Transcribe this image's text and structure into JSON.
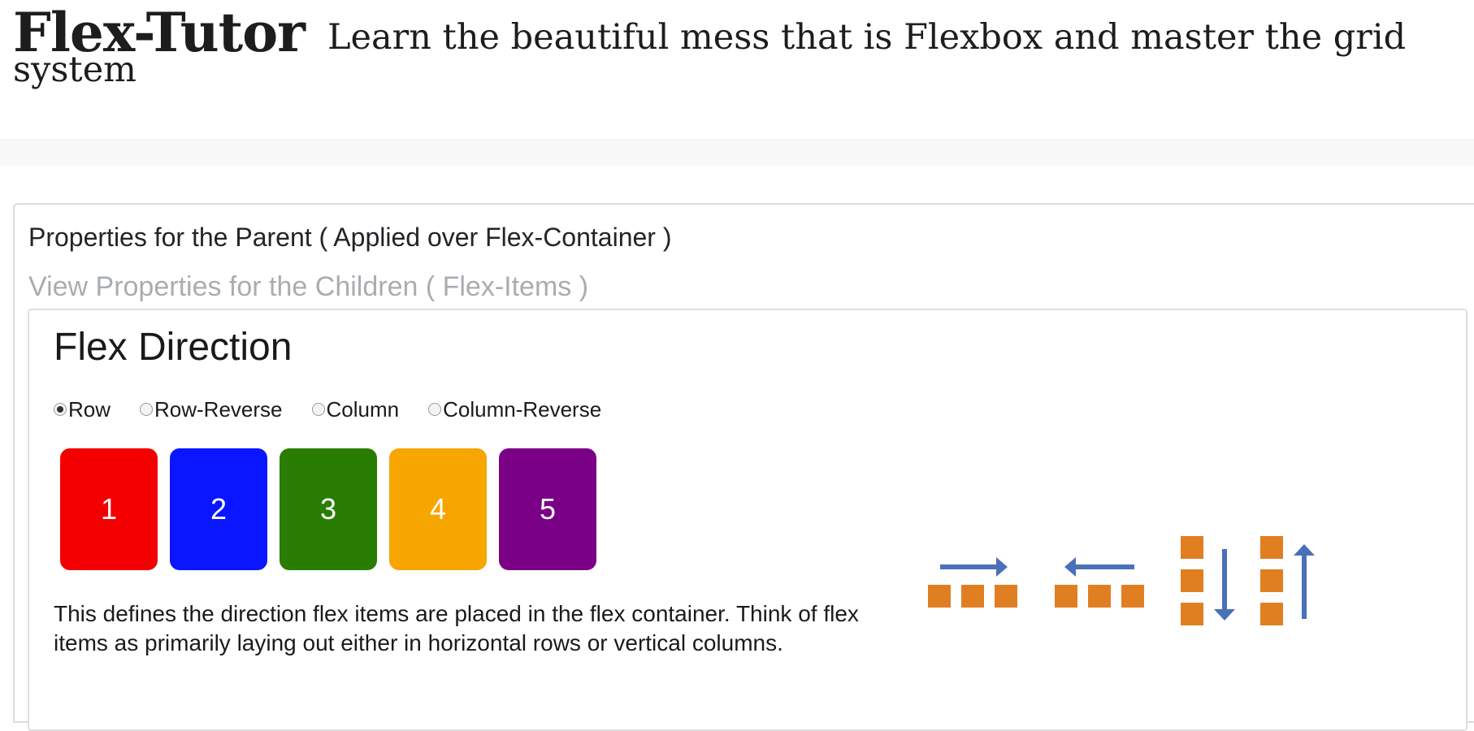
{
  "header": {
    "brand": "Flex-Tutor",
    "tagline_line1": "Learn the beautiful mess that is Flexbox and master the grid",
    "tagline_line2": "system"
  },
  "tabs": {
    "parent_label": "Properties for the Parent ( Applied over Flex-Container )",
    "children_label": "View Properties for the Children ( Flex-Items )"
  },
  "section": {
    "title": "Flex Direction",
    "radio_options": [
      {
        "label": "Row",
        "checked": true
      },
      {
        "label": "Row-Reverse",
        "checked": false
      },
      {
        "label": "Column",
        "checked": false
      },
      {
        "label": "Column-Reverse",
        "checked": false
      }
    ],
    "selected": "Row",
    "items": [
      {
        "label": "1",
        "color": "#f40000"
      },
      {
        "label": "2",
        "color": "#0a16ff"
      },
      {
        "label": "3",
        "color": "#2a7d03"
      },
      {
        "label": "4",
        "color": "#f7a500"
      },
      {
        "label": "5",
        "color": "#7a0185"
      }
    ],
    "description": "This defines the direction flex items are placed in the flex container. Think of flex items as primarily laying out either in horizontal rows or vertical columns."
  },
  "diagram": {
    "square_color": "#e07f22",
    "arrow_color": "#4a70b8",
    "icons": [
      "row-direction-icon",
      "row-reverse-direction-icon",
      "column-direction-icon",
      "column-reverse-direction-icon"
    ]
  }
}
